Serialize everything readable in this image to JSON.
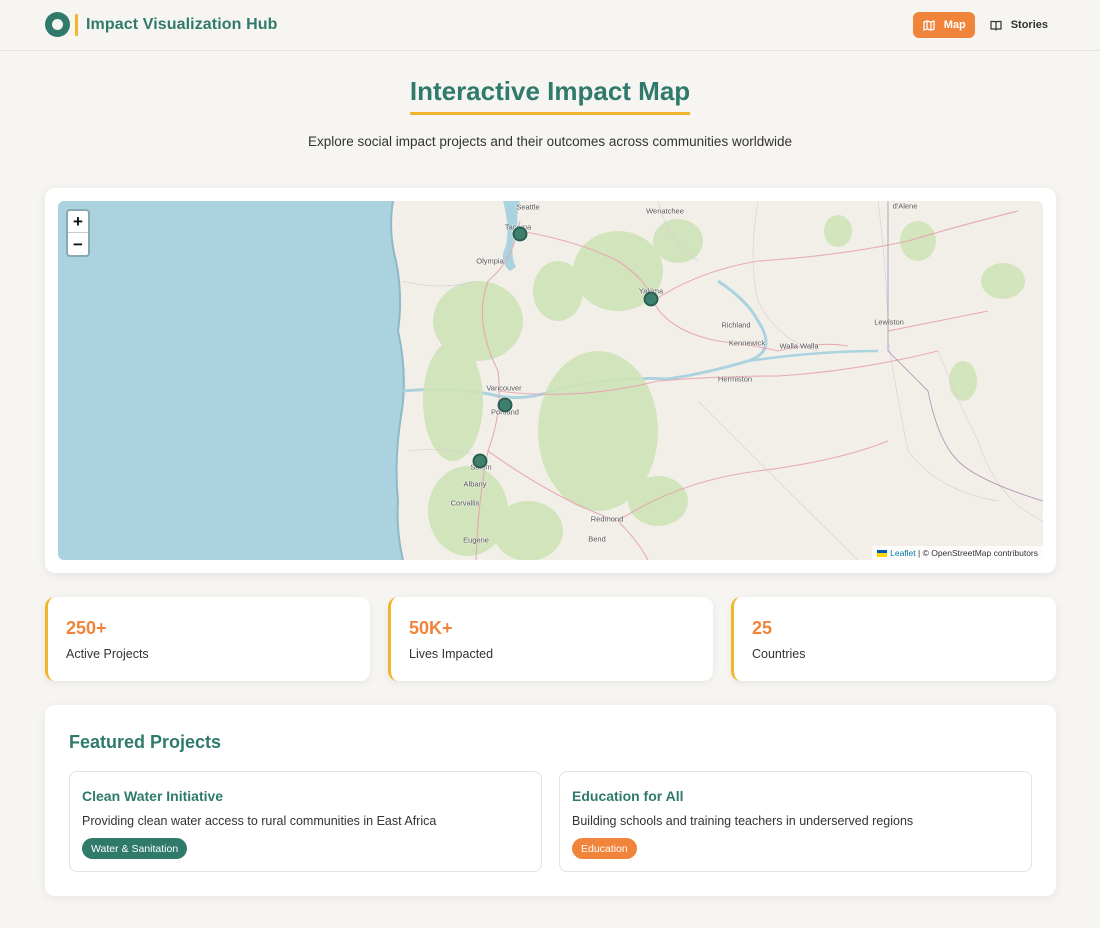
{
  "header": {
    "app_title": "Impact Visualization Hub",
    "nav": [
      {
        "label": "Map",
        "icon": "map-icon",
        "active": true
      },
      {
        "label": "Stories",
        "icon": "book-icon",
        "active": false
      }
    ]
  },
  "hero": {
    "title": "Interactive Impact Map",
    "subtitle": "Explore social impact projects and their outcomes across communities worldwide"
  },
  "map": {
    "zoom_in_label": "+",
    "zoom_out_label": "−",
    "attribution": {
      "leaflet": "Leaflet",
      "separator": " | © ",
      "osm": "OpenStreetMap contributors"
    },
    "cities": [
      "Seattle",
      "Tacoma",
      "Olympia",
      "Wenatchee",
      "Yakima",
      "d'Alene",
      "Richland",
      "Kennewick",
      "Walla Walla",
      "Lewiston",
      "Hermiston",
      "Vancouver",
      "Portland",
      "Salem",
      "Albany",
      "Corvallis",
      "Eugene",
      "Redmond",
      "Bend"
    ],
    "markers": [
      "Tacoma",
      "Yakima",
      "Portland",
      "Salem"
    ]
  },
  "stats": [
    {
      "value": "250+",
      "label": "Active Projects"
    },
    {
      "value": "50K+",
      "label": "Lives Impacted"
    },
    {
      "value": "25",
      "label": "Countries"
    }
  ],
  "featured": {
    "title": "Featured Projects",
    "projects": [
      {
        "title": "Clean Water Initiative",
        "description": "Providing clean water access to rural communities in East Africa",
        "tag": "Water & Sanitation",
        "tag_color": "#2f7a6b"
      },
      {
        "title": "Education for All",
        "description": "Building schools and training teachers in underserved regions",
        "tag": "Education",
        "tag_color": "#f0843a"
      }
    ]
  },
  "colors": {
    "primary": "#2f7a6b",
    "accent": "#f0843a",
    "highlight": "#f0b52a",
    "background": "#f7f5f2",
    "water": "#aad3df",
    "land": "#f2efe9"
  }
}
